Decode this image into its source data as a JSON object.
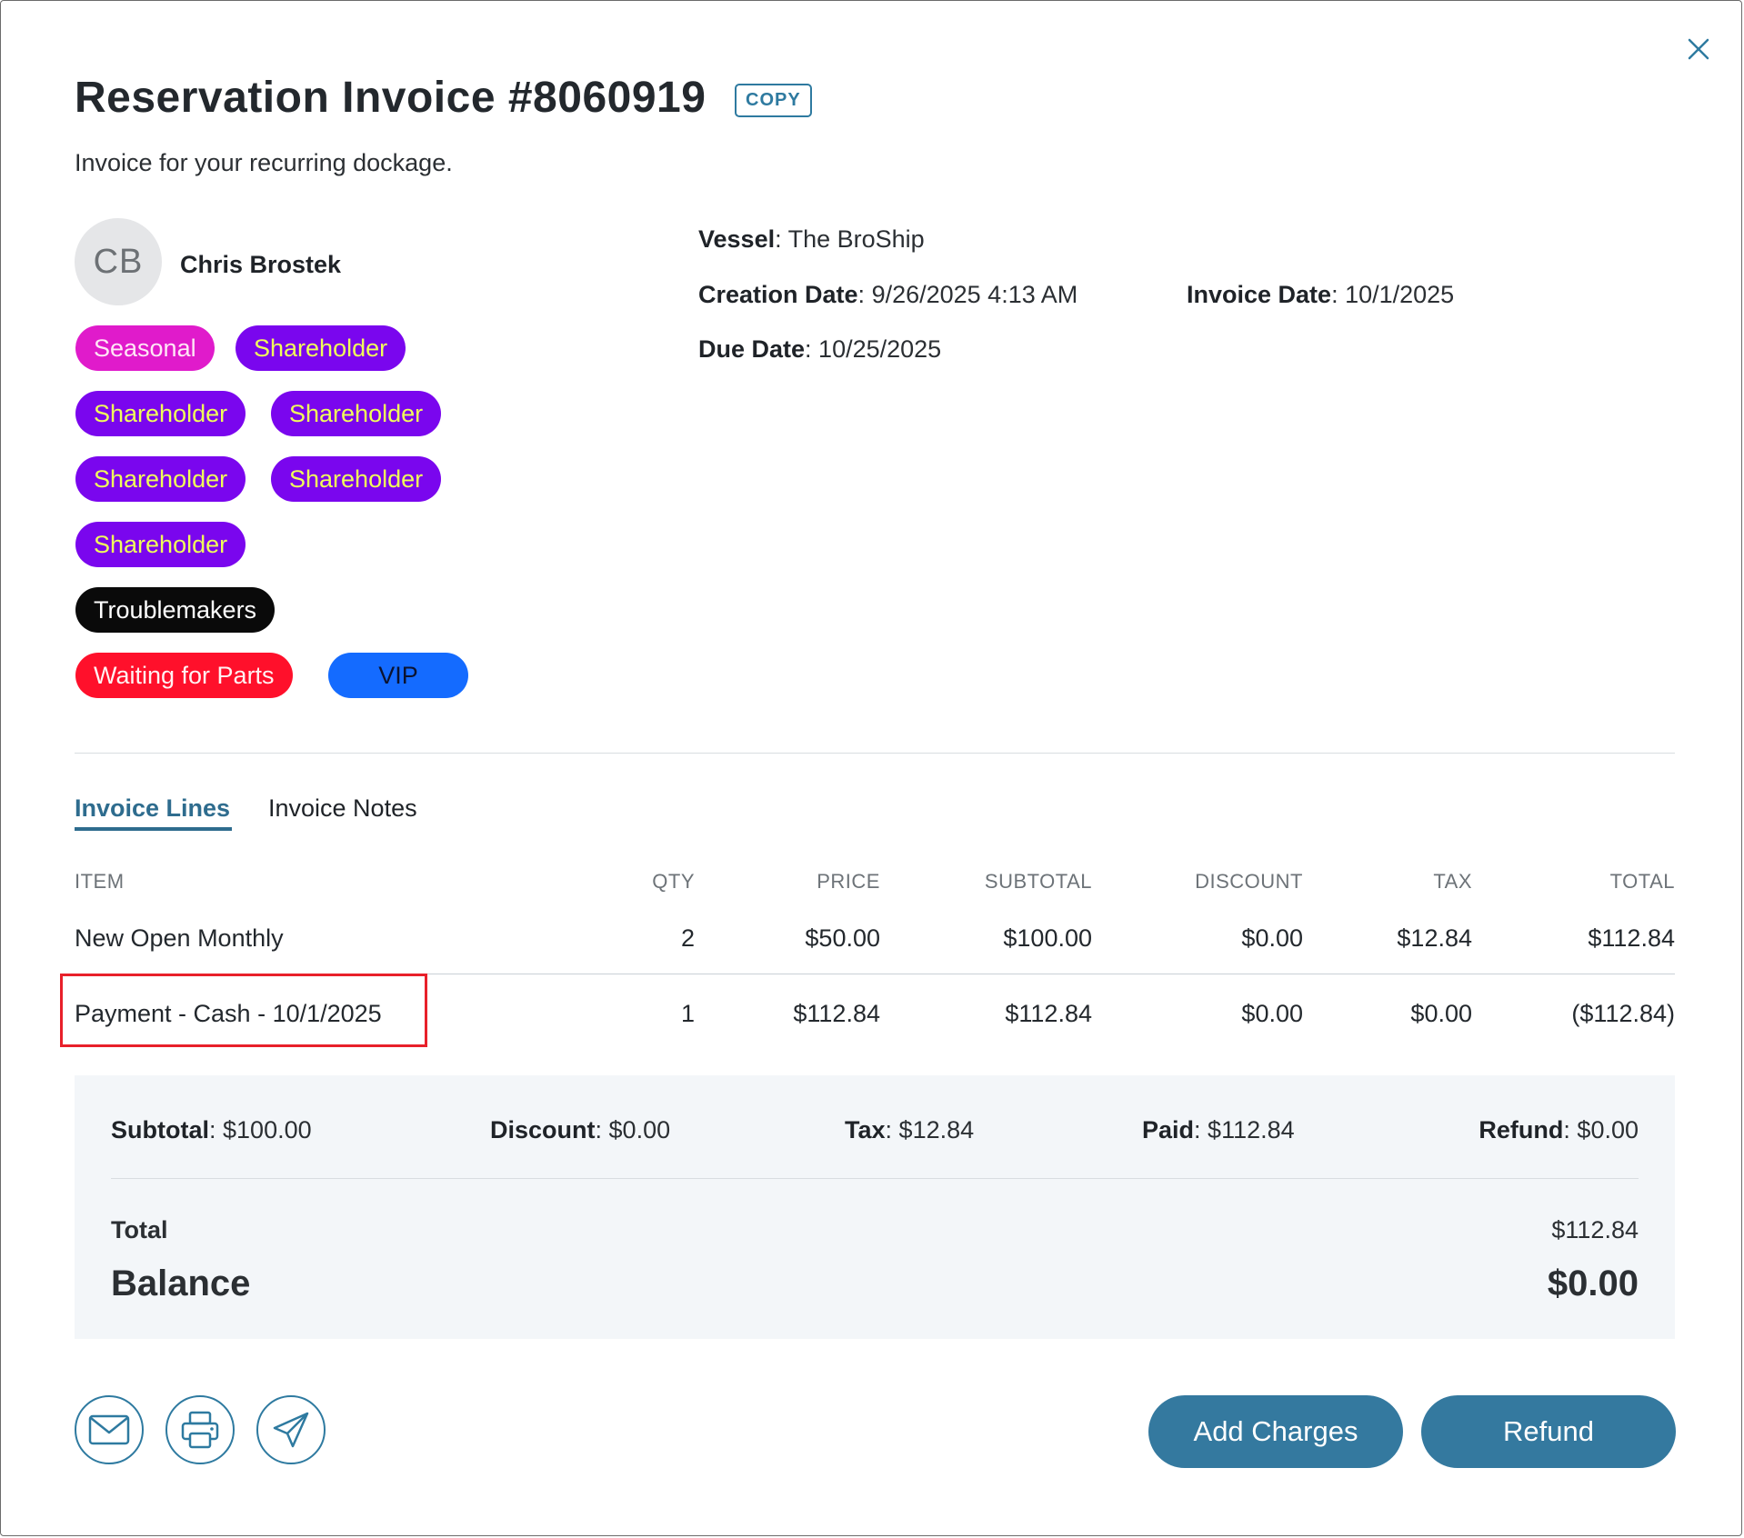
{
  "dialog": {
    "title": "Reservation Invoice #8060919",
    "copy_label": "COPY",
    "subtitle": "Invoice for your recurring dockage."
  },
  "customer": {
    "initials": "CB",
    "name": "Chris Brostek",
    "tags": [
      "Seasonal",
      "Shareholder",
      "Shareholder",
      "Shareholder",
      "Shareholder",
      "Shareholder",
      "Shareholder",
      "Troublemakers",
      "Waiting for Parts",
      "VIP"
    ]
  },
  "details": {
    "vessel_label": "Vessel",
    "vessel": "The BroShip",
    "creation_label": "Creation Date",
    "creation": "9/26/2025 4:13 AM",
    "invoice_date_label": "Invoice Date",
    "invoice_date": "10/1/2025",
    "due_label": "Due Date",
    "due": "10/25/2025"
  },
  "tabs": [
    {
      "label": "Invoice Lines",
      "active": true
    },
    {
      "label": "Invoice Notes",
      "active": false
    }
  ],
  "table": {
    "headers": [
      "ITEM",
      "QTY",
      "PRICE",
      "SUBTOTAL",
      "DISCOUNT",
      "TAX",
      "TOTAL"
    ],
    "rows": [
      {
        "item": "New Open Monthly",
        "qty": "2",
        "price": "$50.00",
        "subtotal": "$100.00",
        "discount": "$0.00",
        "tax": "$12.84",
        "total": "$112.84"
      },
      {
        "item": "Payment - Cash - 10/1/2025",
        "qty": "1",
        "price": "$112.84",
        "subtotal": "$112.84",
        "discount": "$0.00",
        "tax": "$0.00",
        "total": "($112.84)"
      }
    ]
  },
  "summary": {
    "subtotal_label": "Subtotal",
    "subtotal": "$100.00",
    "discount_label": "Discount",
    "discount": "$0.00",
    "tax_label": "Tax",
    "tax": "$12.84",
    "paid_label": "Paid",
    "paid": "$112.84",
    "refund_label": "Refund",
    "refund": "$0.00",
    "total_label": "Total",
    "total": "$112.84",
    "balance_label": "Balance",
    "balance": "$0.00"
  },
  "actions": {
    "add_charges": "Add Charges",
    "refund": "Refund"
  },
  "icons": [
    "close-icon",
    "mail-icon",
    "printer-icon",
    "send-icon"
  ],
  "colors": {
    "accent": "#2e7aa0",
    "button": "#34799f",
    "highlight": "#e8202a",
    "tag_seasonal": "#e01bcb",
    "tag_shareholder": "#7a06ee",
    "tag_troublemakers": "#0a0a0a",
    "tag_waiting_for_parts": "#ff102b",
    "tag_vip": "#146bff"
  }
}
